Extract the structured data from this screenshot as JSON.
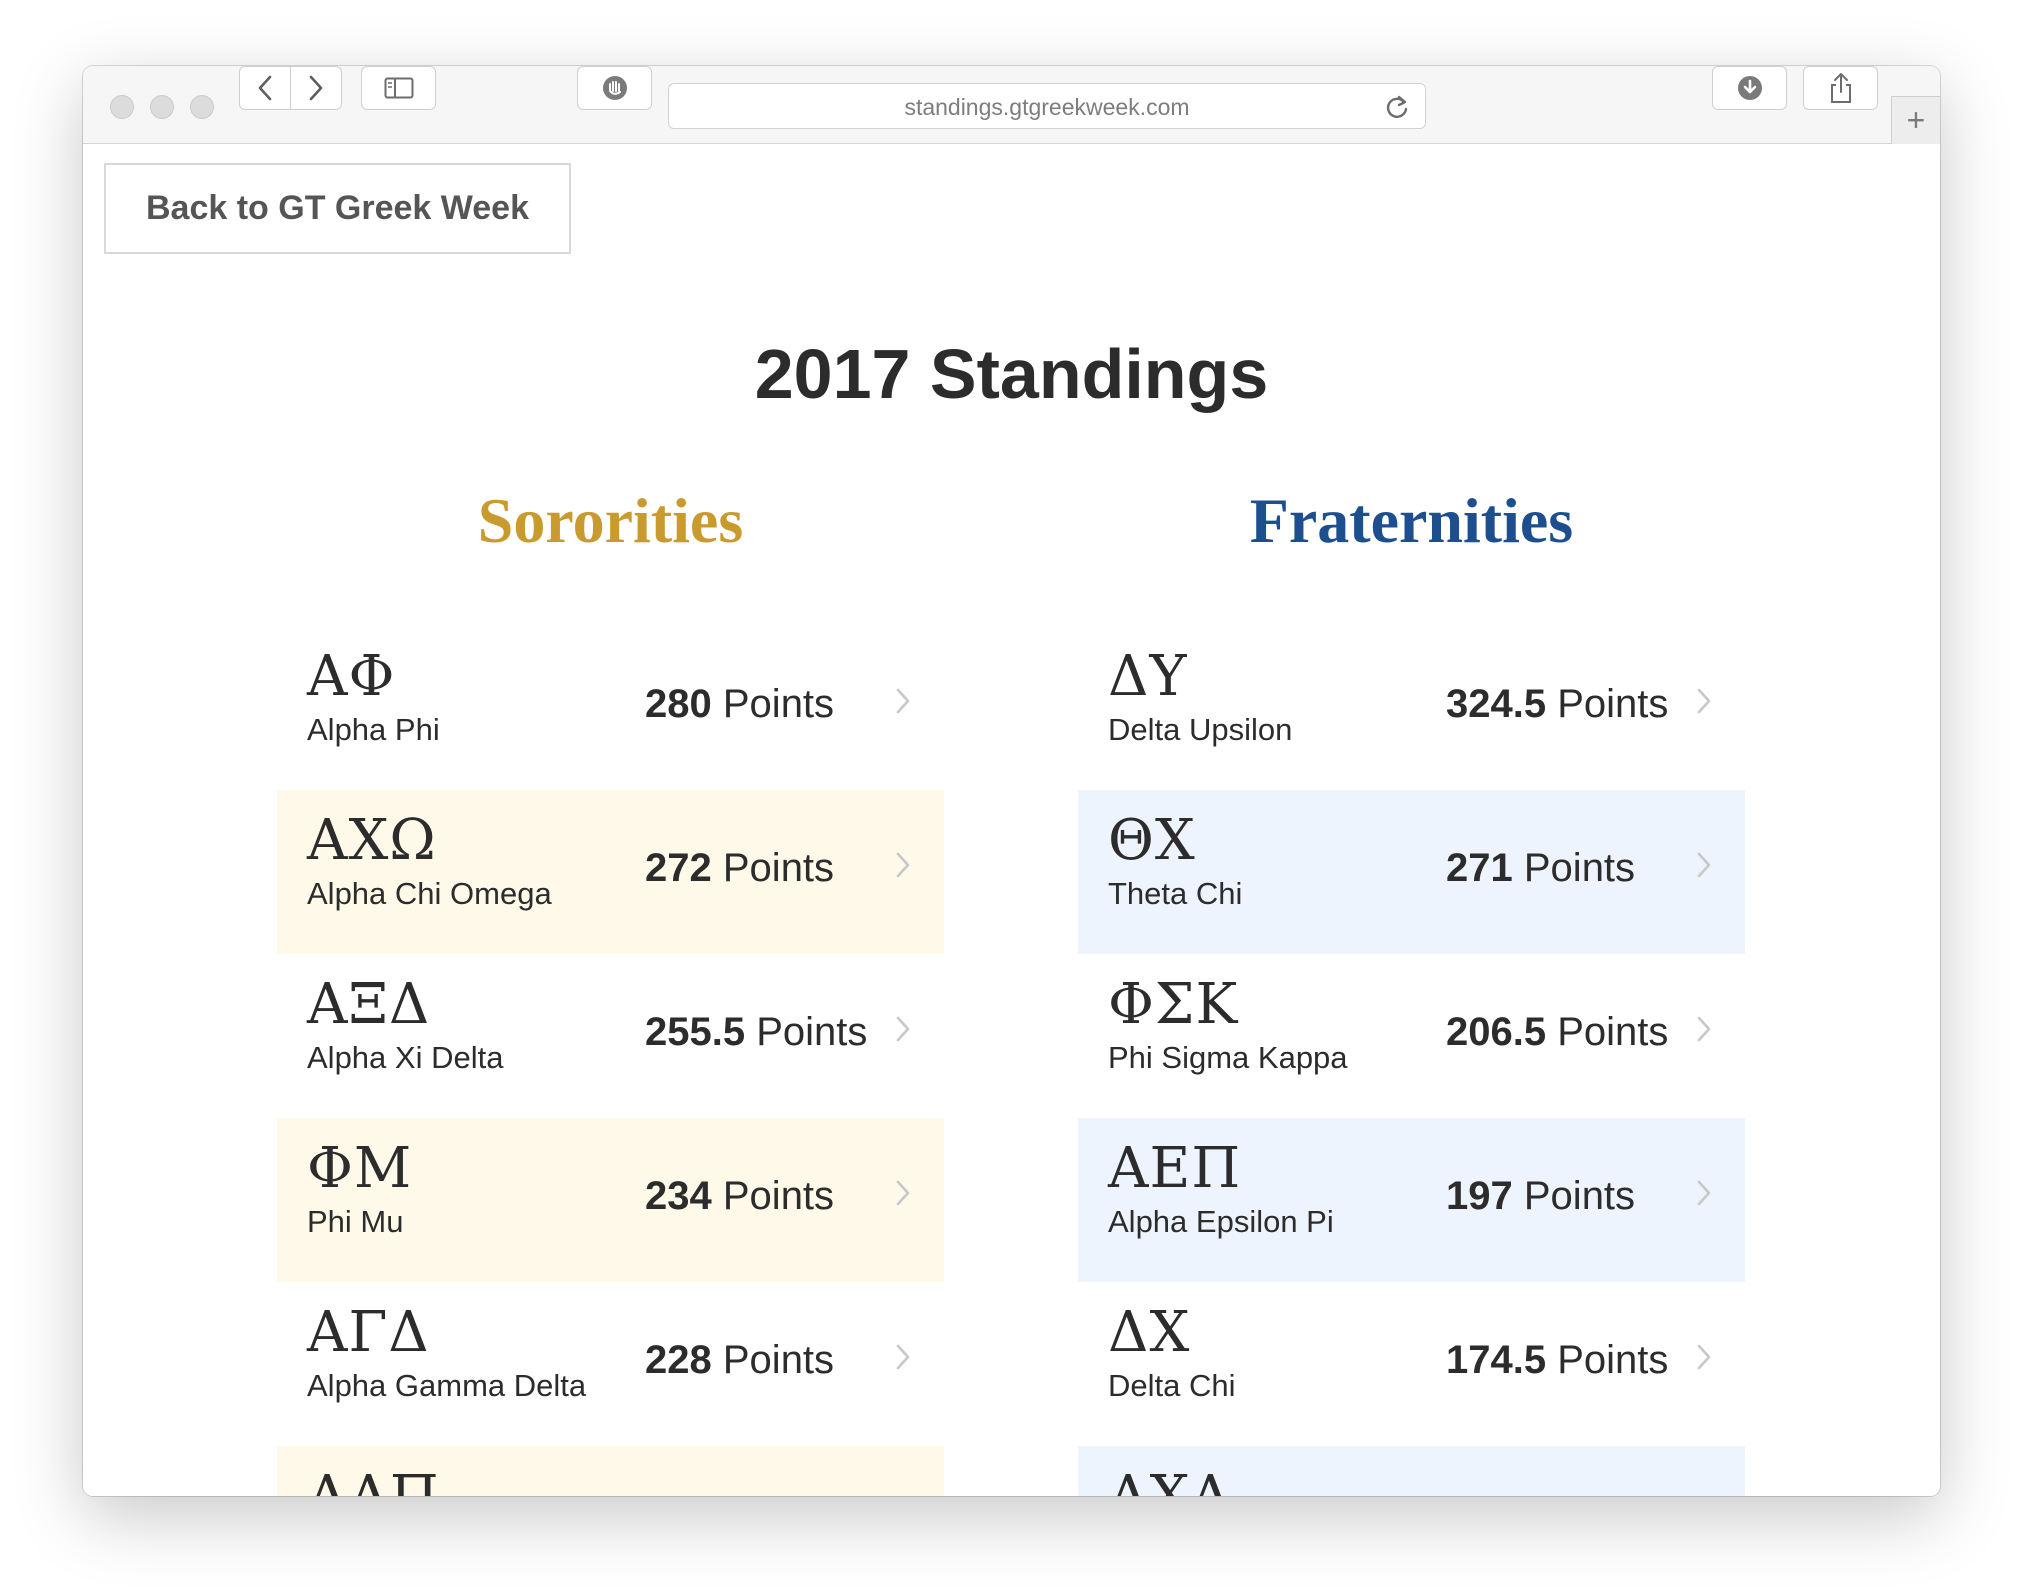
{
  "browser": {
    "url": "standings.gtgreekweek.com",
    "new_tab_label": "+"
  },
  "page": {
    "back_button": "Back to GT Greek Week",
    "title": "2017 Standings"
  },
  "colors": {
    "sorority_accent": "#c99a2e",
    "fraternity_accent": "#1d4f8f",
    "sorority_row_bg": "#fef9e8",
    "fraternity_row_bg": "#edf4fd"
  },
  "points_label": "Points",
  "sororities": {
    "heading": "Sororities",
    "items": [
      {
        "letters": "ΑΦ",
        "name": "Alpha Phi",
        "points": "280"
      },
      {
        "letters": "ΑΧΩ",
        "name": "Alpha Chi Omega",
        "points": "272"
      },
      {
        "letters": "ΑΞΔ",
        "name": "Alpha Xi Delta",
        "points": "255.5"
      },
      {
        "letters": "ΦΜ",
        "name": "Phi Mu",
        "points": "234"
      },
      {
        "letters": "ΑΓΔ",
        "name": "Alpha Gamma Delta",
        "points": "228"
      },
      {
        "letters": "ΑΔΠ",
        "name": "",
        "points": ""
      }
    ]
  },
  "fraternities": {
    "heading": "Fraternities",
    "items": [
      {
        "letters": "ΔΥ",
        "name": "Delta Upsilon",
        "points": "324.5"
      },
      {
        "letters": "ΘΧ",
        "name": "Theta Chi",
        "points": "271"
      },
      {
        "letters": "ΦΣΚ",
        "name": "Phi Sigma Kappa",
        "points": "206.5"
      },
      {
        "letters": "ΑΕΠ",
        "name": "Alpha Epsilon Pi",
        "points": "197"
      },
      {
        "letters": "ΔΧ",
        "name": "Delta Chi",
        "points": "174.5"
      },
      {
        "letters": "ΑΧΑ",
        "name": "",
        "points": ""
      }
    ]
  }
}
